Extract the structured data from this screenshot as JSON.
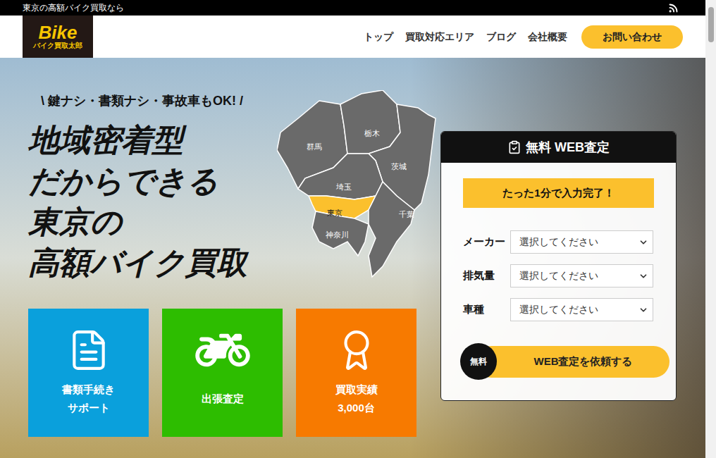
{
  "top_bar": {
    "text": "東京の高額バイク買取なら"
  },
  "logo": {
    "title": "Bike",
    "subtitle": "バイク買取太郎"
  },
  "nav": {
    "items": [
      "トップ",
      "買取対応エリア",
      "ブログ",
      "会社概要"
    ],
    "contact_button": "お問い合わせ"
  },
  "hero": {
    "tagline": "\\ 鍵ナシ・書類ナシ・事故車もOK! /",
    "heading_lines": [
      "地域密着型",
      "だからできる",
      "東京の",
      "高額バイク買取"
    ]
  },
  "map": {
    "regions": [
      {
        "name": "群馬",
        "selected": false
      },
      {
        "name": "栃木",
        "selected": false
      },
      {
        "name": "茨城",
        "selected": false
      },
      {
        "name": "埼玉",
        "selected": false
      },
      {
        "name": "東京",
        "selected": true
      },
      {
        "name": "千葉",
        "selected": false
      },
      {
        "name": "神奈川",
        "selected": false
      }
    ]
  },
  "features": [
    {
      "lines": [
        "書類手続き",
        "サポート"
      ],
      "color": "#0aa0dc",
      "kind": "document"
    },
    {
      "lines": [
        "出張査定"
      ],
      "color": "#2dbd00",
      "kind": "motorcycle"
    },
    {
      "lines": [
        "買取実績",
        "3,000台"
      ],
      "color": "#f77a00",
      "kind": "award"
    }
  ],
  "form": {
    "title": "無料 WEB査定",
    "banner": "たった1分で入力完了！",
    "fields": [
      {
        "label": "メーカー",
        "value": "選択してください"
      },
      {
        "label": "排気量",
        "value": "選択してください"
      },
      {
        "label": "車種",
        "value": "選択してください"
      }
    ],
    "badge": "無料",
    "submit": "WEB査定を依頼する"
  }
}
